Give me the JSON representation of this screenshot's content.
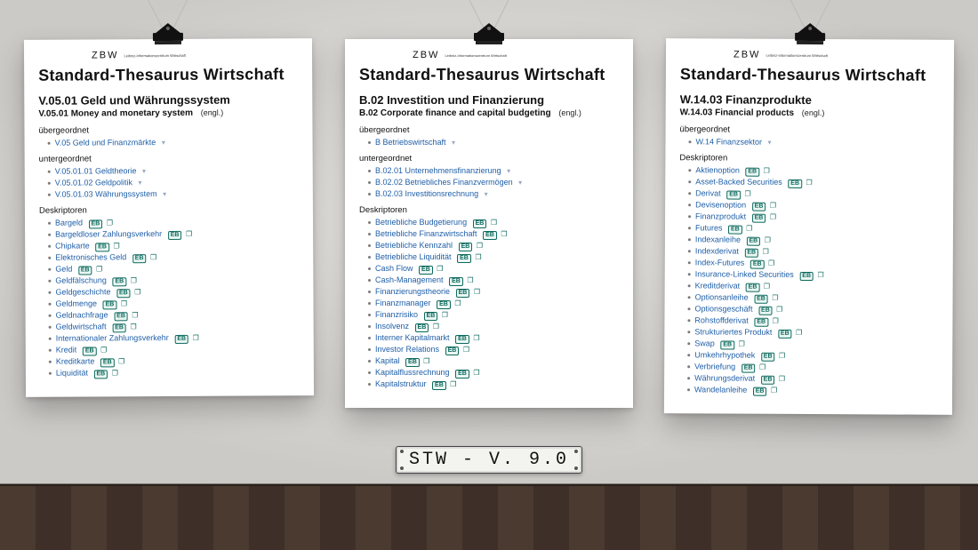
{
  "plaque": "STW - V. 9.0",
  "logo": {
    "word": "ZBW",
    "sub": "Leibniz-Informationszentrum Wirtschaft"
  },
  "title": "Standard-Thesaurus Wirtschaft",
  "engl_tag": "(engl.)",
  "labels": {
    "broader": "übergeordnet",
    "narrower": "untergeordnet",
    "descriptors": "Deskriptoren",
    "eb": "EB"
  },
  "posters": [
    {
      "code": "V.05.01 Geld und Währungssystem",
      "eng": "V.05.01 Money and monetary system",
      "broader": [
        "V.05 Geld und Finanzmärkte"
      ],
      "narrower": [
        "V.05.01.01 Geldtheorie",
        "V.05.01.02 Geldpolitik",
        "V.05.01.03 Währungssystem"
      ],
      "descriptors": [
        "Bargeld",
        "Bargeldloser Zahlungsverkehr",
        "Chipkarte",
        "Elektronisches Geld",
        "Geld",
        "Geldfälschung",
        "Geldgeschichte",
        "Geldmenge",
        "Geldnachfrage",
        "Geldwirtschaft",
        "Internationaler Zahlungsverkehr",
        "Kredit",
        "Kreditkarte",
        "Liquidität"
      ]
    },
    {
      "code": "B.02 Investition und Finanzierung",
      "eng": "B.02 Corporate finance and capital budgeting",
      "broader": [
        "B Betriebswirtschaft"
      ],
      "narrower": [
        "B.02.01 Unternehmensfinanzierung",
        "B.02.02 Betriebliches Finanzvermögen",
        "B.02.03 Investitionsrechnung"
      ],
      "descriptors": [
        "Betriebliche Budgetierung",
        "Betriebliche Finanzwirtschaft",
        "Betriebliche Kennzahl",
        "Betriebliche Liquidität",
        "Cash Flow",
        "Cash-Management",
        "Finanzierungstheorie",
        "Finanzmanager",
        "Finanzrisiko",
        "Insolvenz",
        "Interner Kapitalmarkt",
        "Investor Relations",
        "Kapital",
        "Kapitalflussrechnung",
        "Kapitalstruktur"
      ]
    },
    {
      "code": "W.14.03 Finanzprodukte",
      "eng": "W.14.03 Financial products",
      "broader": [
        "W.14 Finanzsektor"
      ],
      "narrower": [],
      "descriptors": [
        "Aktienoption",
        "Asset-Backed Securities",
        "Derivat",
        "Devisenoption",
        "Finanzprodukt",
        "Futures",
        "Indexanleihe",
        "Indexderivat",
        "Index-Futures",
        "Insurance-Linked Securities",
        "Kreditderivat",
        "Optionsanleihe",
        "Optionsgeschäft",
        "Rohstoffderivat",
        "Strukturiertes Produkt",
        "Swap",
        "Umkehrhypothek",
        "Verbriefung",
        "Währungsderivat",
        "Wandelanleihe"
      ]
    }
  ]
}
